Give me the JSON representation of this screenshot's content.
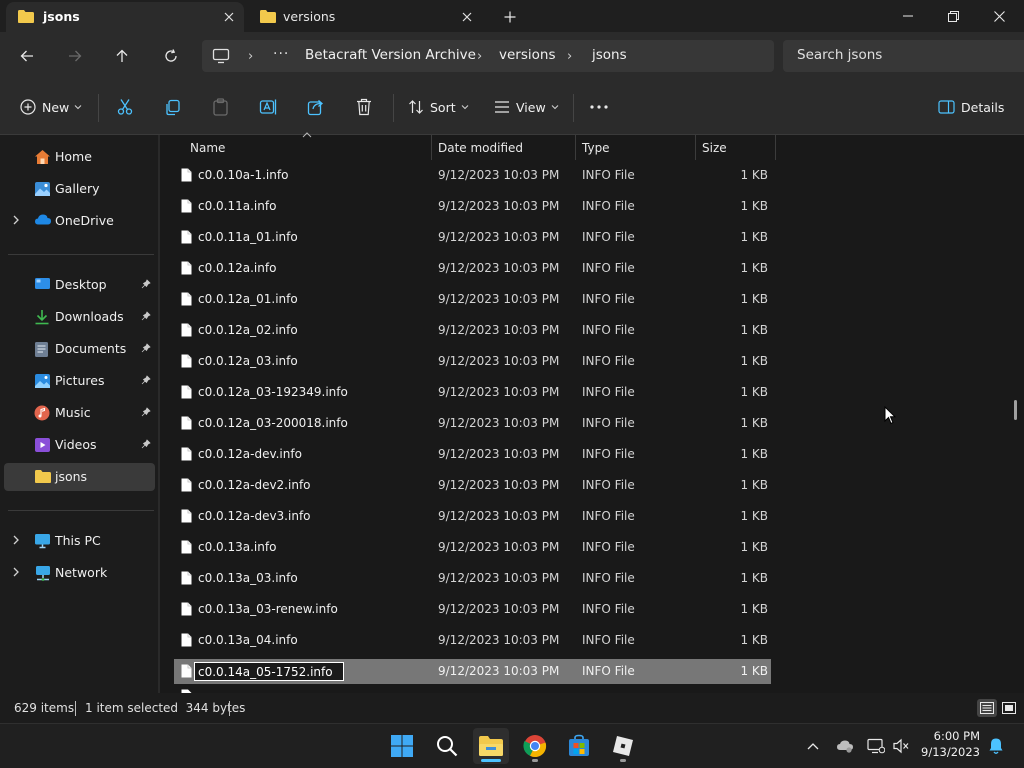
{
  "window": {
    "tabs": [
      {
        "label": "jsons",
        "active": true
      },
      {
        "label": "versions",
        "active": false
      }
    ]
  },
  "address": {
    "breadcrumbs": [
      "Betacraft Version Archive",
      "versions",
      "jsons"
    ],
    "search_placeholder": "Search jsons"
  },
  "toolbar": {
    "new_label": "New",
    "sort_label": "Sort",
    "view_label": "View",
    "details_label": "Details"
  },
  "sidebar": {
    "home": "Home",
    "gallery": "Gallery",
    "onedrive": "OneDrive",
    "quick_access": [
      {
        "label": "Desktop"
      },
      {
        "label": "Downloads"
      },
      {
        "label": "Documents"
      },
      {
        "label": "Pictures"
      },
      {
        "label": "Music"
      },
      {
        "label": "Videos"
      },
      {
        "label": "jsons"
      }
    ],
    "this_pc": "This PC",
    "network": "Network"
  },
  "columns": {
    "name": "Name",
    "date": "Date modified",
    "type": "Type",
    "size": "Size"
  },
  "files": [
    {
      "name": "c0.0.10a-1.info",
      "date": "9/12/2023 10:03 PM",
      "type": "INFO File",
      "size": "1 KB"
    },
    {
      "name": "c0.0.11a.info",
      "date": "9/12/2023 10:03 PM",
      "type": "INFO File",
      "size": "1 KB"
    },
    {
      "name": "c0.0.11a_01.info",
      "date": "9/12/2023 10:03 PM",
      "type": "INFO File",
      "size": "1 KB"
    },
    {
      "name": "c0.0.12a.info",
      "date": "9/12/2023 10:03 PM",
      "type": "INFO File",
      "size": "1 KB"
    },
    {
      "name": "c0.0.12a_01.info",
      "date": "9/12/2023 10:03 PM",
      "type": "INFO File",
      "size": "1 KB"
    },
    {
      "name": "c0.0.12a_02.info",
      "date": "9/12/2023 10:03 PM",
      "type": "INFO File",
      "size": "1 KB"
    },
    {
      "name": "c0.0.12a_03.info",
      "date": "9/12/2023 10:03 PM",
      "type": "INFO File",
      "size": "1 KB"
    },
    {
      "name": "c0.0.12a_03-192349.info",
      "date": "9/12/2023 10:03 PM",
      "type": "INFO File",
      "size": "1 KB"
    },
    {
      "name": "c0.0.12a_03-200018.info",
      "date": "9/12/2023 10:03 PM",
      "type": "INFO File",
      "size": "1 KB"
    },
    {
      "name": "c0.0.12a-dev.info",
      "date": "9/12/2023 10:03 PM",
      "type": "INFO File",
      "size": "1 KB"
    },
    {
      "name": "c0.0.12a-dev2.info",
      "date": "9/12/2023 10:03 PM",
      "type": "INFO File",
      "size": "1 KB"
    },
    {
      "name": "c0.0.12a-dev3.info",
      "date": "9/12/2023 10:03 PM",
      "type": "INFO File",
      "size": "1 KB"
    },
    {
      "name": "c0.0.13a.info",
      "date": "9/12/2023 10:03 PM",
      "type": "INFO File",
      "size": "1 KB"
    },
    {
      "name": "c0.0.13a_03.info",
      "date": "9/12/2023 10:03 PM",
      "type": "INFO File",
      "size": "1 KB"
    },
    {
      "name": "c0.0.13a_03-renew.info",
      "date": "9/12/2023 10:03 PM",
      "type": "INFO File",
      "size": "1 KB"
    },
    {
      "name": "c0.0.13a_04.info",
      "date": "9/12/2023 10:03 PM",
      "type": "INFO File",
      "size": "1 KB"
    }
  ],
  "renaming": {
    "name": "c0.0.14a_05-1752.info",
    "date": "9/12/2023 10:03 PM",
    "type": "INFO File",
    "size": "1 KB"
  },
  "status": {
    "item_count": "629 items",
    "selection": "1 item selected  344 bytes"
  },
  "clock": {
    "time": "6:00 PM",
    "date": "9/13/2023"
  },
  "colors": {
    "folder": "#f2c94c",
    "accent": "#4cc2ff",
    "selected_row": "#777777"
  }
}
